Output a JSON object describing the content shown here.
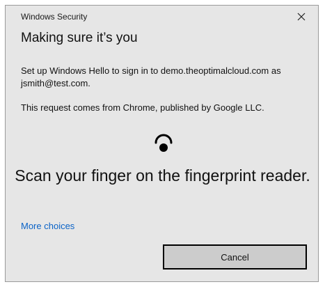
{
  "window": {
    "title": "Windows Security",
    "close_icon": "close-icon"
  },
  "dialog": {
    "heading": "Making sure it’s you",
    "description": "Set up Windows Hello to sign in to demo.theoptimalcloud.com as jsmith@test.com.",
    "origin": "This request comes from Chrome, published by Google LLC.",
    "icon": "fingerprint-icon",
    "instruction": "Scan your finger on the fingerprint reader.",
    "more_choices_label": "More choices",
    "cancel_label": "Cancel"
  },
  "colors": {
    "dialog_background": "#e6e6e6",
    "link": "#0b63c7",
    "button_background": "#cccccc",
    "button_border": "#000000"
  }
}
